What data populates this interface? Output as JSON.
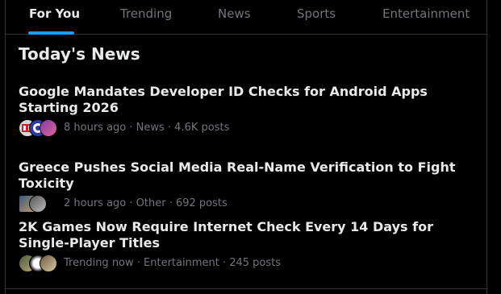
{
  "tabs": [
    {
      "label": "For You",
      "active": true
    },
    {
      "label": "Trending",
      "active": false
    },
    {
      "label": "News",
      "active": false
    },
    {
      "label": "Sports",
      "active": false
    },
    {
      "label": "Entertainment",
      "active": false
    }
  ],
  "section": {
    "title": "Today's News"
  },
  "stories": [
    {
      "headline": "Google Mandates Developer ID Checks for Android Apps Starting 2026",
      "meta": "8 hours ago · News · 4.6K posts",
      "avatars": [
        "news-logo-avatar",
        "tech-logo-avatar",
        "user-avatar"
      ]
    },
    {
      "headline": "Greece Pushes Social Media Real-Name Verification to Fight Toxicity",
      "meta": "2 hours ago · Other · 692 posts",
      "avatars": [
        "user-avatar",
        "user-avatar"
      ]
    },
    {
      "headline": "2K Games Now Require Internet Check Every 14 Days for Single-Player Titles",
      "meta": "Trending now · Entertainment · 245 posts",
      "avatars": [
        "user-avatar",
        "user-avatar",
        "user-avatar"
      ]
    }
  ],
  "colors": {
    "background": "#000000",
    "text_primary": "#e7e9ea",
    "text_secondary": "#71767b",
    "accent": "#1d9bf0",
    "border": "#2f3336"
  }
}
